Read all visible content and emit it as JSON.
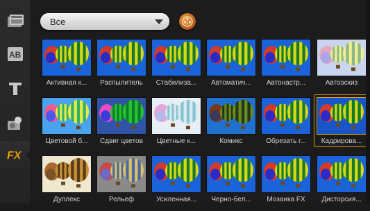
{
  "category": {
    "selected": "Все"
  },
  "effects": [
    {
      "label": "Активная к...",
      "style": "normal"
    },
    {
      "label": "Распылитель",
      "style": "normal"
    },
    {
      "label": "Стабилиза...",
      "style": "normal"
    },
    {
      "label": "Автоматич...",
      "style": "normal"
    },
    {
      "label": "Автонастр...",
      "style": "normal"
    },
    {
      "label": "Автоэскиз",
      "style": "sketch"
    },
    {
      "label": "Цветовой б...",
      "style": "light"
    },
    {
      "label": "Сдвиг цветов",
      "style": "shift"
    },
    {
      "label": "Цветные к...",
      "style": "pencil"
    },
    {
      "label": "Комикс",
      "style": "comic"
    },
    {
      "label": "Обрезать г...",
      "style": "normal"
    },
    {
      "label": "Кадрирова...",
      "style": "crop"
    },
    {
      "label": "Дуплекс",
      "style": "duplex"
    },
    {
      "label": "Рельеф",
      "style": "emboss"
    },
    {
      "label": "Усиленная...",
      "style": "normal"
    },
    {
      "label": "Черно-бел...",
      "style": "normal"
    },
    {
      "label": "Мозаика FX",
      "style": "normal"
    },
    {
      "label": "Дисторсия...",
      "style": "normal"
    }
  ],
  "selected_index": 11,
  "rail": [
    {
      "name": "instant-project-icon"
    },
    {
      "name": "title-ab-icon"
    },
    {
      "name": "text-t-icon"
    },
    {
      "name": "graphics-icon"
    },
    {
      "name": "fx-icon"
    }
  ]
}
